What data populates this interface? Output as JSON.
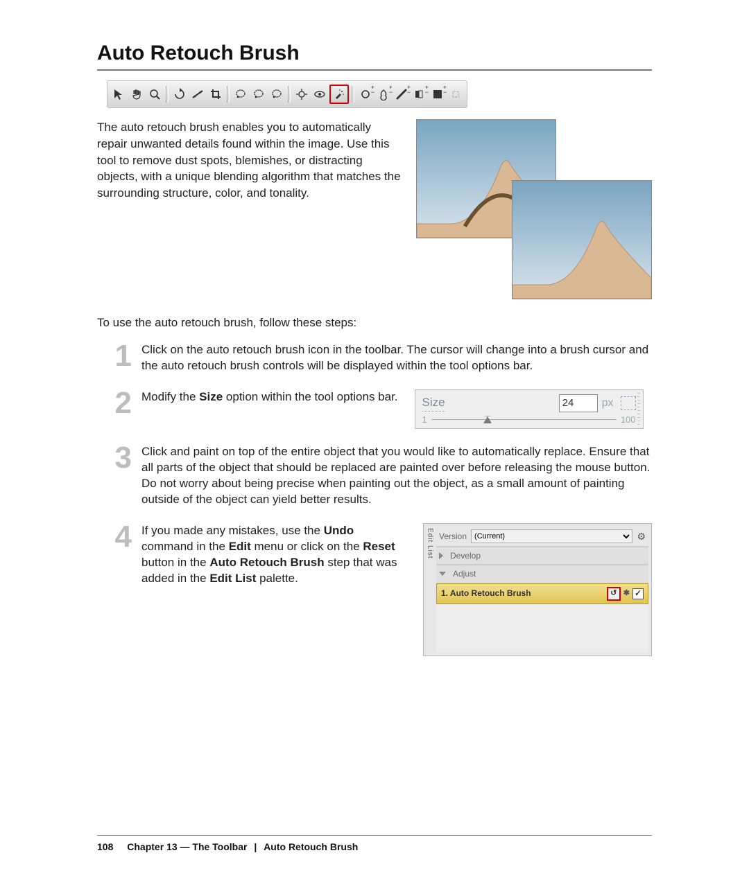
{
  "title": "Auto Retouch Brush",
  "toolbar": {
    "icons": [
      {
        "name": "move-tool-icon"
      },
      {
        "name": "hand-tool-icon"
      },
      {
        "name": "zoom-tool-icon"
      },
      {
        "sep": true
      },
      {
        "name": "rotate-icon"
      },
      {
        "name": "straighten-icon"
      },
      {
        "name": "crop-icon"
      },
      {
        "sep": true
      },
      {
        "name": "lasso-a-icon"
      },
      {
        "name": "lasso-b-icon"
      },
      {
        "name": "lasso-c-icon"
      },
      {
        "sep": true
      },
      {
        "name": "white-balance-icon"
      },
      {
        "name": "eye-icon"
      },
      {
        "name": "auto-retouch-brush-icon",
        "selected": true
      },
      {
        "sep": true
      },
      {
        "name": "dodge-icon",
        "pm": true
      },
      {
        "name": "burn-icon",
        "pm": true
      },
      {
        "name": "brush-icon",
        "pm": true
      },
      {
        "name": "gradient-icon",
        "pm": true
      },
      {
        "name": "texture-icon",
        "pm": true
      },
      {
        "name": "trailing-icon"
      }
    ]
  },
  "intro": "The auto retouch brush enables you to automatically repair unwanted details found within the image. Use this tool to remove dust spots, blemishes, or distracting objects, with a unique blending algorithm that matches the surrounding structure, color, and tonality.",
  "stepsLead": "To use the auto retouch brush, follow these steps:",
  "steps": {
    "s1": {
      "num": "1",
      "text": "Click on the auto retouch brush icon in the toolbar. The cursor will change into a brush cursor and the auto retouch brush controls will be displayed within the tool options bar."
    },
    "s2": {
      "num": "2",
      "pre": "Modify the ",
      "b1": "Size",
      "post": " option within the tool options bar."
    },
    "s3": {
      "num": "3",
      "text": "Click and paint on top of the entire object that you would like to automatically replace. Ensure that all parts of the object that should be replaced are painted over before releasing the mouse button. Do not worry about being precise when painting out the object, as a small amount of painting outside of the object can yield better results."
    },
    "s4": {
      "num": "4",
      "p1": "If you made any mistakes, use the ",
      "b1": "Undo",
      "p2": " command in the ",
      "b2": "Edit",
      "p3": " menu or click on the ",
      "b3": "Reset",
      "p4": " button in the ",
      "b4": "Auto Retouch Brush",
      "p5": " step that was added in the ",
      "b5": "Edit List",
      "p6": " palette."
    }
  },
  "sizePanel": {
    "label": "Size",
    "value": "24",
    "unit": "px",
    "min": "1",
    "max": "100"
  },
  "editList": {
    "side": "Edit List",
    "versionLabel": "Version",
    "versionValue": "(Current)",
    "develop": "Develop",
    "adjust": "Adjust",
    "step": "1. Auto Retouch Brush",
    "check": "✓",
    "reset": "↺"
  },
  "footer": {
    "page": "108",
    "chapter": "Chapter 13 — The Toolbar",
    "topic": "Auto Retouch Brush"
  }
}
